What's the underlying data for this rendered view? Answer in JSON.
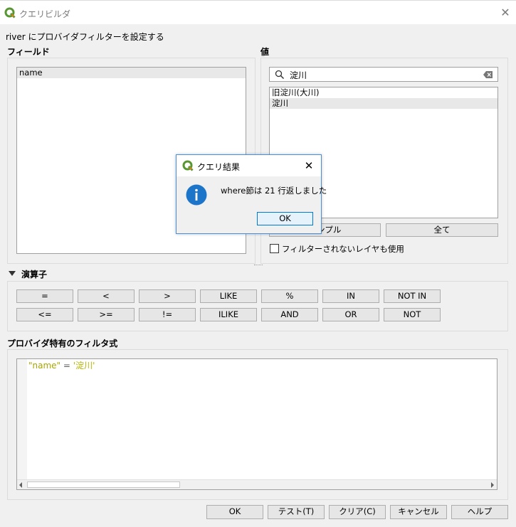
{
  "window": {
    "title": "クエリビルダ",
    "close_glyph": "✕"
  },
  "description": "river にプロバイダフィルターを設定する",
  "fields": {
    "heading": "フィールド",
    "items": [
      "name"
    ]
  },
  "values": {
    "heading": "値",
    "search_value": "淀川",
    "items": [
      "旧淀川(大川)",
      "淀川"
    ],
    "sample_button": "サンプル",
    "all_button": "全て",
    "unfiltered_checkbox_label": "フィルターされないレイヤも使用",
    "unfiltered_checked": false
  },
  "operators": {
    "heading": "演算子",
    "row1": [
      "=",
      "<",
      ">",
      "LIKE",
      "%",
      "IN",
      "NOT IN"
    ],
    "row2": [
      "<=",
      ">=",
      "!=",
      "ILIKE",
      "AND",
      "OR",
      "NOT"
    ]
  },
  "expression": {
    "heading": "プロバイダ特有のフィルタ式",
    "field_token": "\"name\"",
    "operator_token": " = ",
    "value_token": "'淀川'"
  },
  "footer": {
    "ok": "OK",
    "test": "テスト(T)",
    "clear": "クリア(C)",
    "cancel": "キャンセル",
    "help": "ヘルプ"
  },
  "result_dialog": {
    "title": "クエリ結果",
    "close_glyph": "✕",
    "message": "where節は 21 行返しました",
    "ok": "OK"
  },
  "colors": {
    "qgis_green": "#589632",
    "qgis_yellow": "#ee7913",
    "info_blue": "#1c75c8",
    "default_button_border": "#0078d7"
  }
}
